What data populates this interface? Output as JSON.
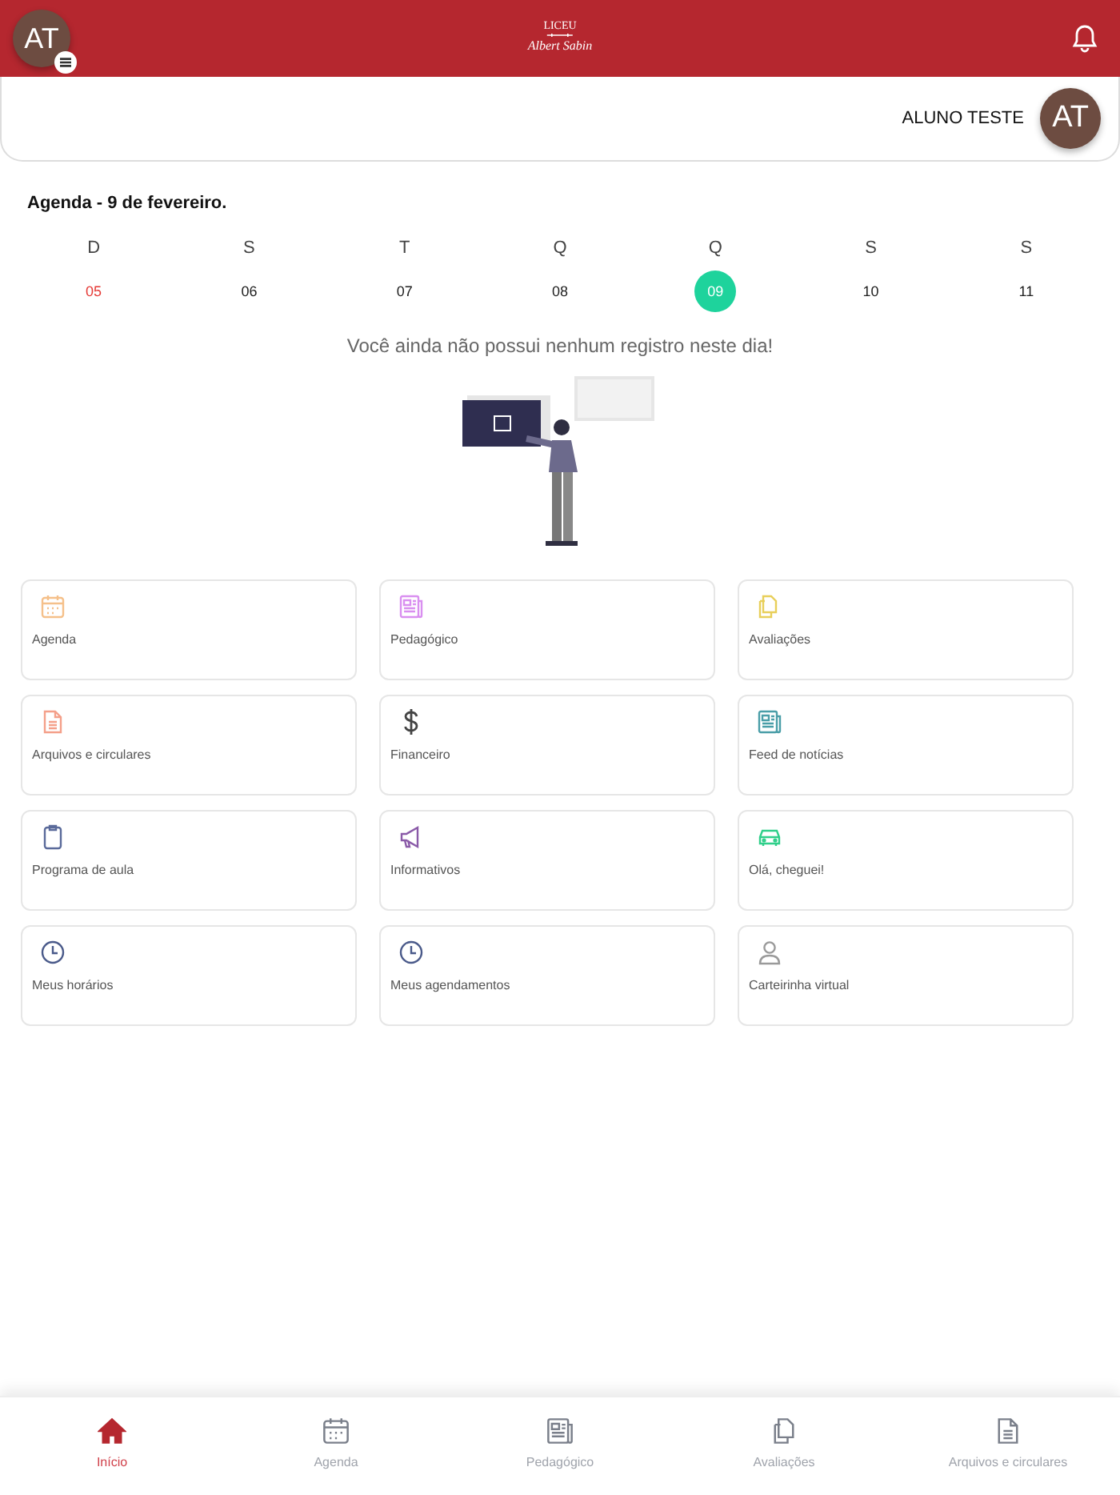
{
  "header": {
    "avatar_initials": "AT",
    "logo_top": "LICEU",
    "logo_bottom": "Albert Sabin"
  },
  "profile": {
    "name": "ALUNO TESTE",
    "initials": "AT"
  },
  "agenda": {
    "title": "Agenda - 9 de fevereiro.",
    "days": [
      {
        "letter": "D",
        "number": "05",
        "highlighted": true,
        "selected": false
      },
      {
        "letter": "S",
        "number": "06",
        "highlighted": false,
        "selected": false
      },
      {
        "letter": "T",
        "number": "07",
        "highlighted": false,
        "selected": false
      },
      {
        "letter": "Q",
        "number": "08",
        "highlighted": false,
        "selected": false
      },
      {
        "letter": "Q",
        "number": "09",
        "highlighted": false,
        "selected": true
      },
      {
        "letter": "S",
        "number": "10",
        "highlighted": false,
        "selected": false
      },
      {
        "letter": "S",
        "number": "11",
        "highlighted": false,
        "selected": false
      }
    ],
    "empty_message": "Você ainda não possui nenhum registro neste dia!"
  },
  "tiles": [
    {
      "label": "Agenda",
      "color": "#f5c08a"
    },
    {
      "label": "Pedagógico",
      "color": "#d98ff0"
    },
    {
      "label": "Avaliações",
      "color": "#e8cf5a"
    },
    {
      "label": "Arquivos e circulares",
      "color": "#f4a08a"
    },
    {
      "label": "Financeiro",
      "color": "#444444"
    },
    {
      "label": "Feed de notícias",
      "color": "#4a9ea8"
    },
    {
      "label": "Programa de aula",
      "color": "#5a6a9a"
    },
    {
      "label": "Informativos",
      "color": "#8a5aa8"
    },
    {
      "label": "Olá, cheguei!",
      "color": "#2fcf8a"
    },
    {
      "label": "Meus horários",
      "color": "#4a5a8a"
    },
    {
      "label": "Meus agendamentos",
      "color": "#4a5a8a"
    },
    {
      "label": "Carteirinha virtual",
      "color": "#9a9a9a"
    }
  ],
  "bottom_nav": [
    {
      "label": "Início",
      "selected": true
    },
    {
      "label": "Agenda",
      "selected": false
    },
    {
      "label": "Pedagógico",
      "selected": false
    },
    {
      "label": "Avaliações",
      "selected": false
    },
    {
      "label": "Arquivos e circulares",
      "selected": false
    }
  ]
}
